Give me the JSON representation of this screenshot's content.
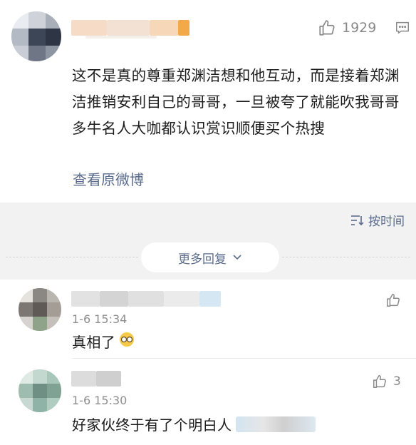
{
  "main_comment": {
    "like_count": "1929",
    "text": "这不是真的尊重郑渊洁想和他互动，而是接着郑渊洁推销安利自己的哥哥，一旦被夸了就能吹我哥哥多牛名人大咖都认识赏识顺便买个热搜",
    "view_original_label": "查看原微博"
  },
  "sort": {
    "label": "按时间"
  },
  "more_replies": {
    "label": "更多回复"
  },
  "replies": [
    {
      "time": "1-6 15:34",
      "text": "真相了",
      "like_count": ""
    },
    {
      "time": "1-6 15:30",
      "text": "好家伙终于有了个明白人",
      "like_count": "3"
    }
  ],
  "colors": {
    "link": "#5b6c8c",
    "meta": "#8a8a8a",
    "band": "#f2f2f2"
  }
}
